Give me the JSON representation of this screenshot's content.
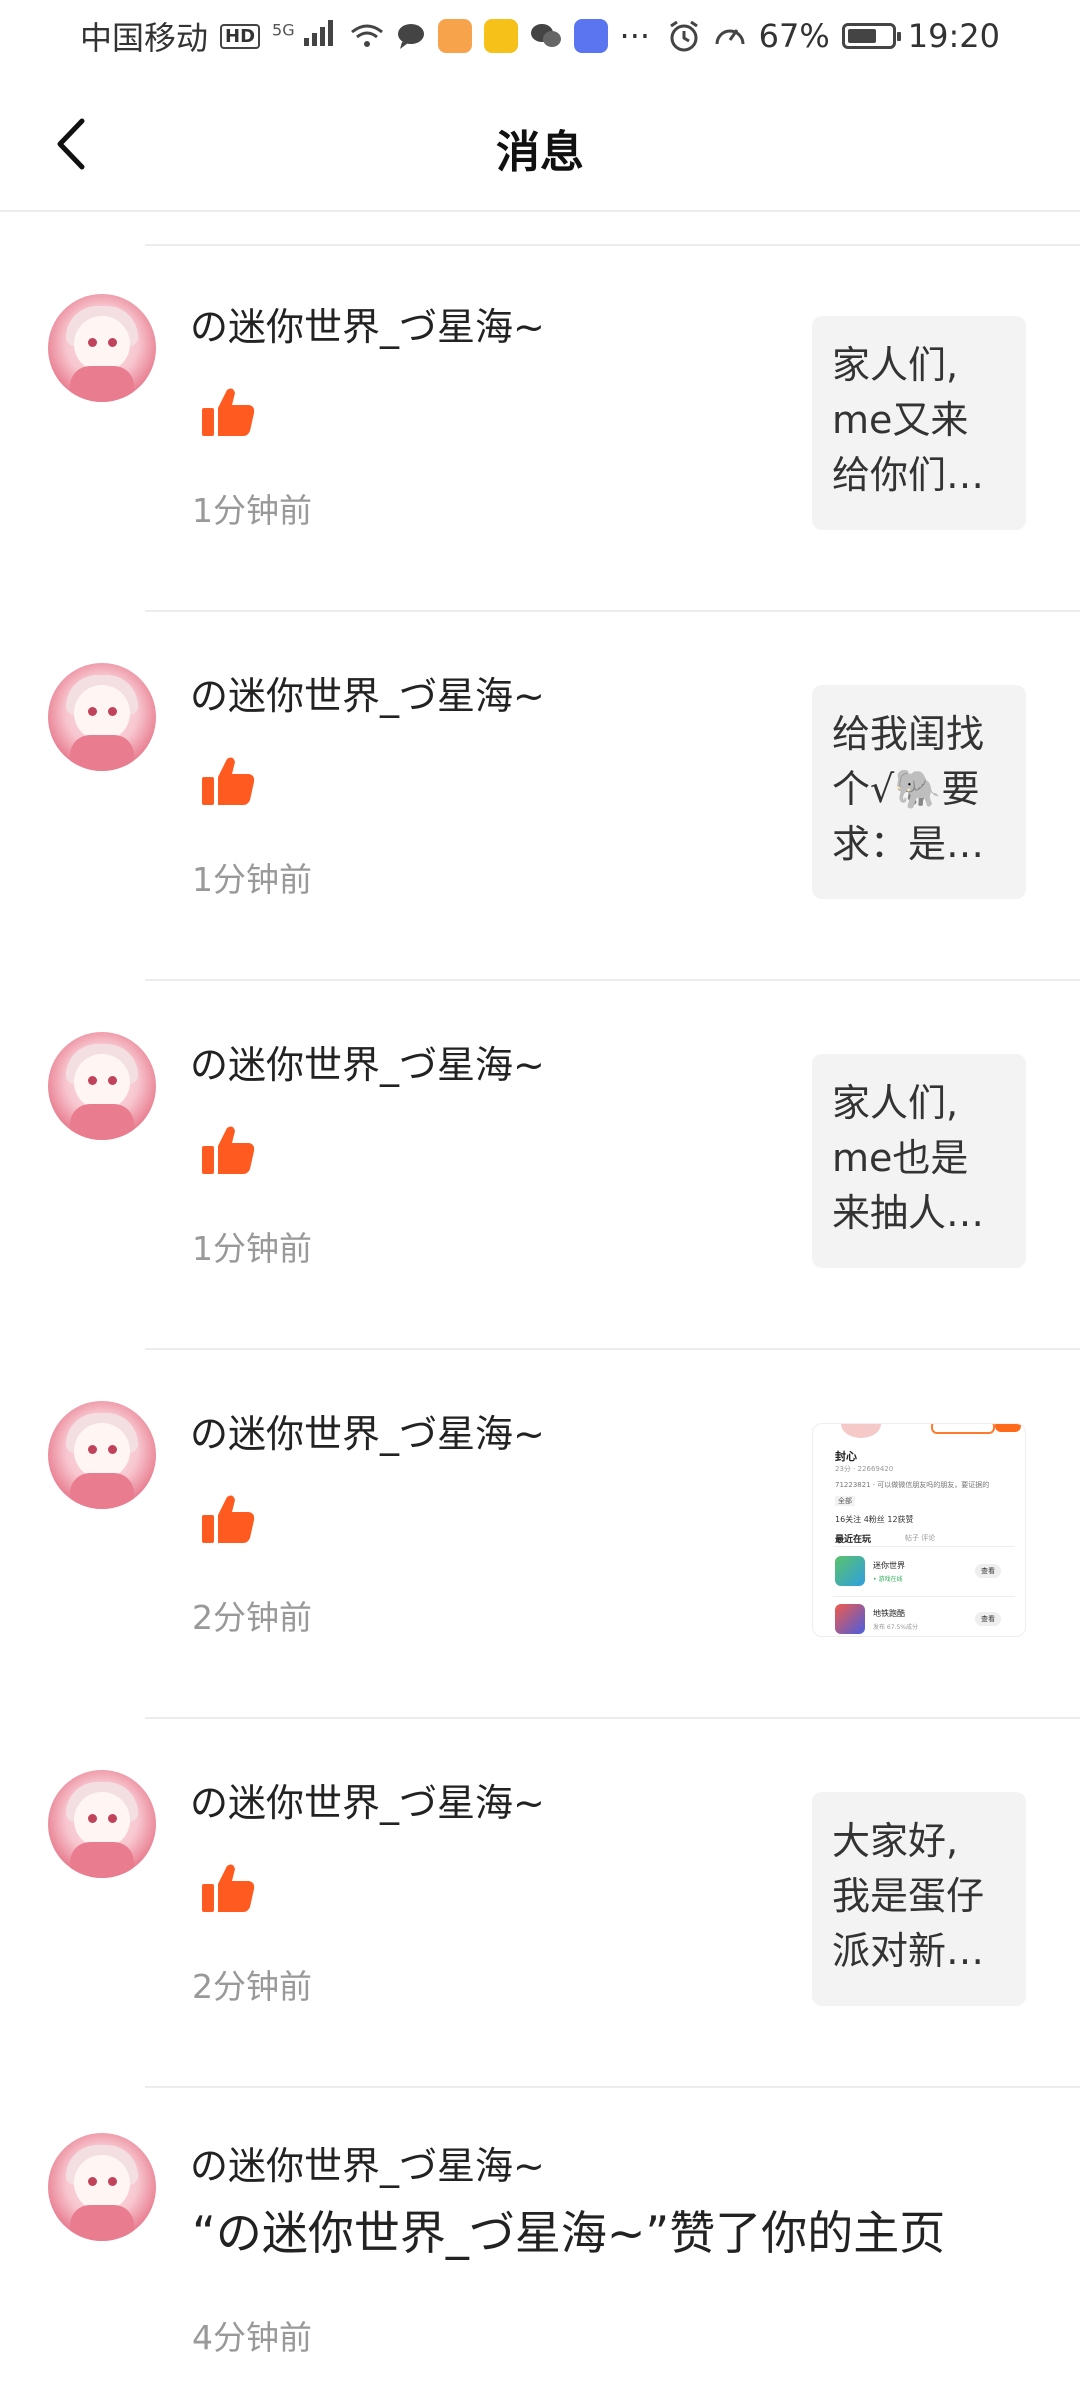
{
  "status_bar": {
    "carrier": "中国移动",
    "hd": "HD",
    "network": "5G",
    "more": "···",
    "battery_percent": "67%",
    "battery_level": 0.67,
    "time": "19:20"
  },
  "header": {
    "title": "消息"
  },
  "messages": [
    {
      "user": "の迷你世界_づ星海~",
      "time": "1分钟前",
      "preview": [
        "家人们,",
        "me又来",
        "给你们…"
      ]
    },
    {
      "user": "の迷你世界_づ星海~",
      "time": "1分钟前",
      "preview": [
        "给我闺找",
        "个√🐘要",
        "求：是…"
      ]
    },
    {
      "user": "の迷你世界_づ星海~",
      "time": "1分钟前",
      "preview": [
        "家人们,",
        "me也是",
        "来抽人…"
      ]
    },
    {
      "user": "の迷你世界_づ星海~",
      "time": "2分钟前",
      "thumbnail": {
        "name": "封心",
        "subtitle": "23分 · 22669420",
        "bio": "71223821 · 可以做微信朋友吗的朋友，要证据的",
        "tag": "全部",
        "stats": "16关注   4粉丝   12获赞",
        "section": "最近在玩",
        "tabs": "帖子   评论",
        "apps": [
          {
            "name": "迷你世界",
            "meta": "• 游戏在线",
            "button": "查看"
          },
          {
            "name": "地铁跑酷",
            "meta": "发布 67.5%成分",
            "button": "查看"
          }
        ]
      }
    },
    {
      "user": "の迷你世界_づ星海~",
      "time": "2分钟前",
      "preview": [
        "大家好,",
        "我是蛋仔",
        "派对新…"
      ]
    }
  ],
  "last_message": {
    "user": "の迷你世界_づ星海~",
    "text": "“の迷你世界_づ星海~”赞了你的主页",
    "time": "4分钟前"
  },
  "colors": {
    "like": "#ff5a1f",
    "divider": "#ececec",
    "preview_bg": "#f3f3f3",
    "time_text": "#999999"
  },
  "icons": {
    "back": "chevron-left-icon",
    "like": "thumbs-up-icon"
  }
}
